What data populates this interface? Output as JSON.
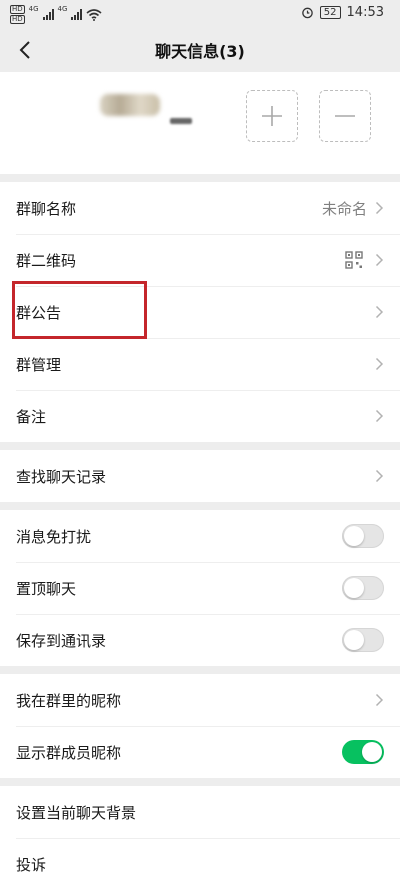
{
  "statusbar": {
    "network_left": "4G",
    "network_right": "4G",
    "hd1": "HD",
    "hd2": "HD",
    "battery": "52",
    "time": "14:53"
  },
  "navbar": {
    "title": "聊天信息(3)"
  },
  "settings": {
    "group_name_label": "群聊名称",
    "group_name_value": "未命名",
    "qr_code_label": "群二维码",
    "announcement_label": "群公告",
    "manage_label": "群管理",
    "remark_label": "备注",
    "search_history_label": "查找聊天记录",
    "mute_label": "消息免打扰",
    "pin_label": "置顶聊天",
    "save_contacts_label": "保存到通讯录",
    "my_nickname_label": "我在群里的昵称",
    "show_nicknames_label": "显示群成员昵称",
    "background_label": "设置当前聊天背景",
    "complain_label": "投诉"
  },
  "toggles": {
    "mute": false,
    "pin": false,
    "save_contacts": false,
    "show_nicknames": true
  },
  "colors": {
    "accent_green": "#07c160",
    "highlight_red": "#c4262b"
  }
}
